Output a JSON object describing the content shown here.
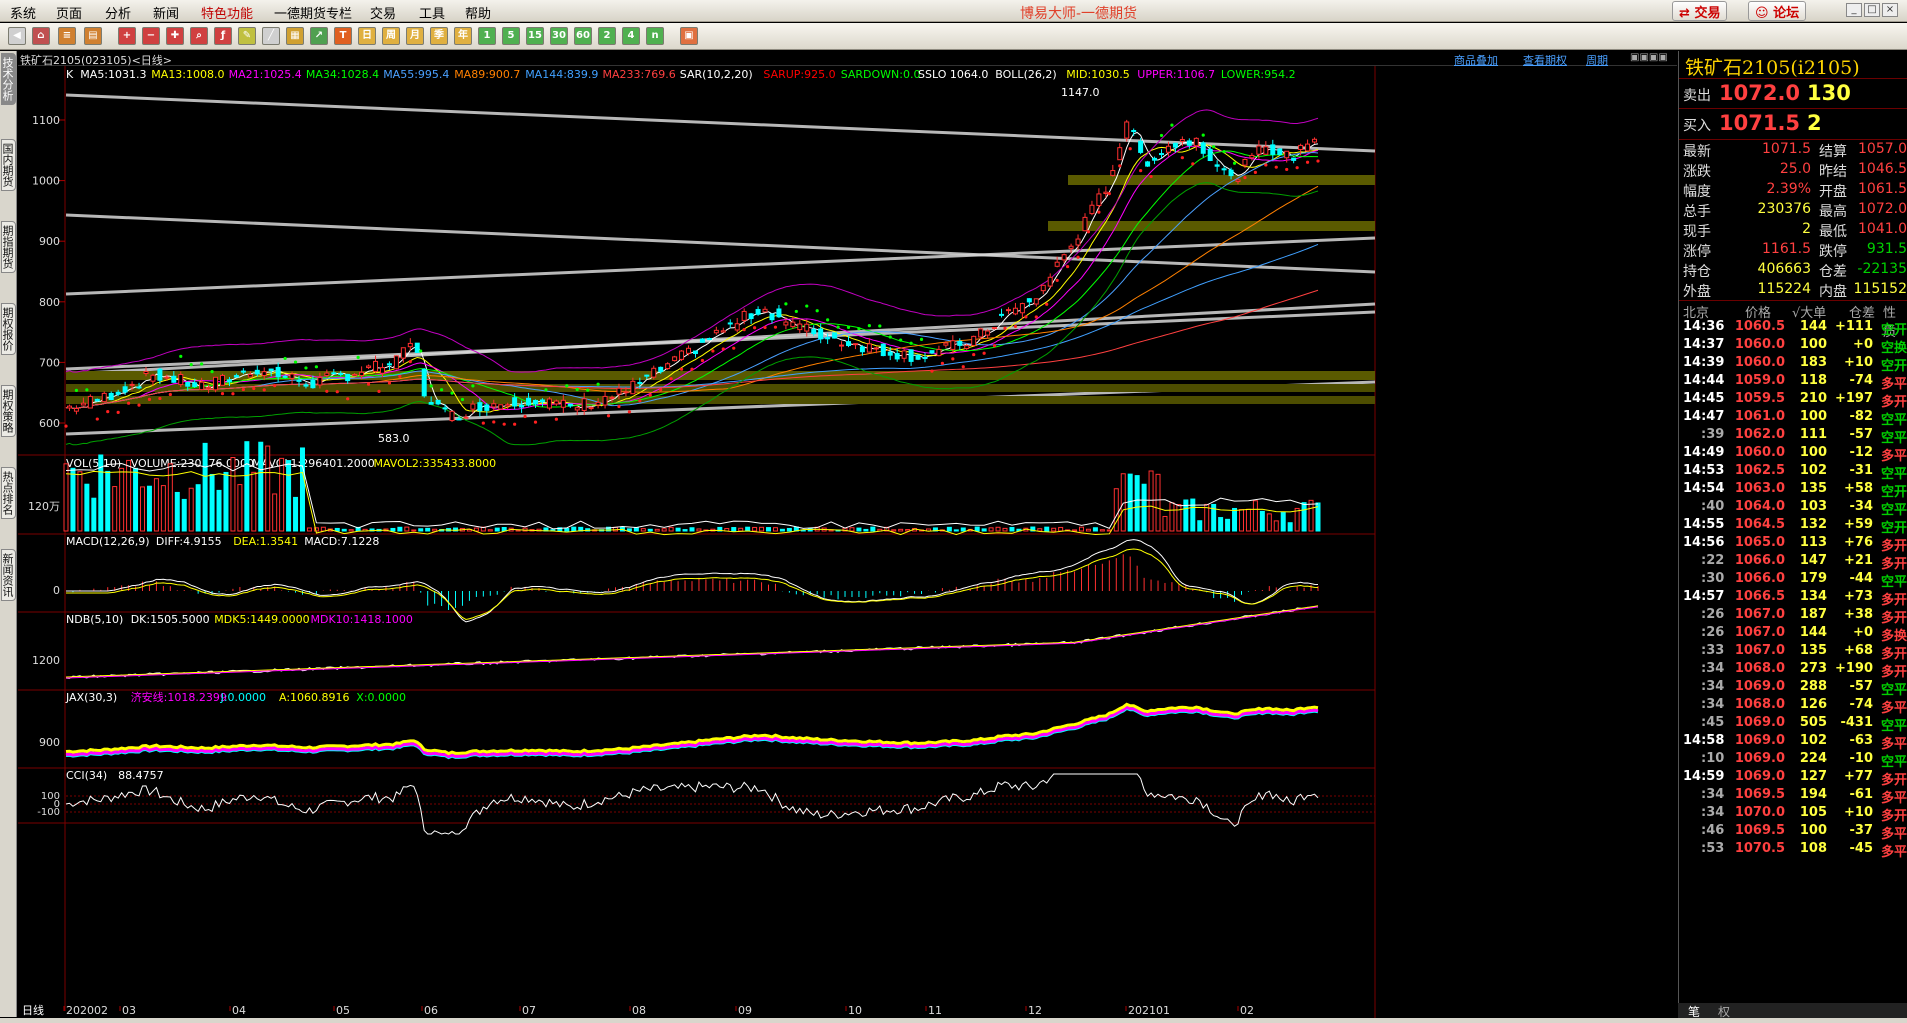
{
  "menu": {
    "items": [
      "系统",
      "页面",
      "分析",
      "新闻",
      "特色功能",
      "一德期货专栏",
      "交易",
      "工具",
      "帮助"
    ],
    "app_title": "博易大师-一德期货",
    "trade_button": "交易",
    "forum_button": "论坛"
  },
  "toolbar": {
    "period_buttons": [
      "周",
      "月",
      "季",
      "年",
      "1",
      "5",
      "15",
      "30",
      "60"
    ]
  },
  "sidebar": {
    "tabs": [
      "技术分析",
      "国内期货",
      "期指期货",
      "期权报价",
      "期权策略",
      "热点排名",
      "新闻资讯"
    ]
  },
  "chart": {
    "instrument": "铁矿石2105(023105)<日线>",
    "header_links": [
      "商品叠加",
      "查看期权",
      "周期"
    ],
    "ma_legend": [
      {
        "text": "K",
        "color": "#ffffff"
      },
      {
        "text": "MA5:1031.3",
        "color": "#ffffff"
      },
      {
        "text": "MA13:1008.0",
        "color": "#ffff00"
      },
      {
        "text": "MA21:1025.4",
        "color": "#ff00ff"
      },
      {
        "text": "MA34:1028.4",
        "color": "#00ff00"
      },
      {
        "text": "MA55:995.4",
        "color": "#4aa0ff"
      },
      {
        "text": "MA89:900.7",
        "color": "#ff8000"
      },
      {
        "text": "MA144:839.9",
        "color": "#40a0ff"
      },
      {
        "text": "MA233:769.6",
        "color": "#ff4040"
      },
      {
        "text": "SAR(10,2,20)",
        "color": "#ffffff"
      },
      {
        "text": "SARUP:925.0",
        "color": "#ff0000"
      },
      {
        "text": "SARDOWN:0.0",
        "color": "#00ff00"
      },
      {
        "text": "SSLO 1064.0",
        "color": "#ffffff"
      },
      {
        "text": "BOLL(26,2)",
        "color": "#ffffff"
      },
      {
        "text": "MID:1030.5",
        "color": "#ffff00"
      },
      {
        "text": "UPPER:1106.7",
        "color": "#ff00ff"
      },
      {
        "text": "LOWER:954.2",
        "color": "#00ff00"
      }
    ],
    "price_ticks": [
      "1100",
      "1000",
      "900",
      "800",
      "700",
      "600"
    ],
    "high_label": "1147.0",
    "low_label": "583.0",
    "vol_legend": [
      {
        "text": "VOL(5,10)",
        "color": "#ffffff"
      },
      {
        "text": "VOLUME:230376.0000",
        "color": "#ffffff"
      },
      {
        "text": "MAVOL1:296401.2000",
        "color": "#ffffff"
      },
      {
        "text": "MAVOL2:335433.8000",
        "color": "#ffff00"
      }
    ],
    "vol_tick": "120万",
    "macd_legend": [
      {
        "text": "MACD(12,26,9)",
        "color": "#ffffff"
      },
      {
        "text": "DIFF:4.9155",
        "color": "#ffffff"
      },
      {
        "text": "DEA:1.3541",
        "color": "#ffff00"
      },
      {
        "text": "MACD:7.1228",
        "color": "#ffffff"
      }
    ],
    "macd_tick": "0",
    "ndb_legend": [
      {
        "text": "NDB(5,10)",
        "color": "#ffffff"
      },
      {
        "text": "DK:1505.5000",
        "color": "#ffffff"
      },
      {
        "text": "MDK5:1449.0000",
        "color": "#ffff00"
      },
      {
        "text": "MDK10:1418.1000",
        "color": "#ff00ff"
      }
    ],
    "ndb_tick": "1200",
    "jax_legend": [
      {
        "text": "JAX(30,3)",
        "color": "#ffffff"
      },
      {
        "text": "济安线:1018.2399",
        "color": "#ff00ff"
      },
      {
        "text": "J:0.0000",
        "color": "#00ffff"
      },
      {
        "text": "A:1060.8916",
        "color": "#ffff00"
      },
      {
        "text": "X:0.0000",
        "color": "#00ff00"
      }
    ],
    "jax_tick": "900",
    "cci_legend": [
      {
        "text": "CCI(34)",
        "color": "#ffffff"
      },
      {
        "text": "88.4757",
        "color": "#ffffff"
      }
    ],
    "cci_ticks": [
      "100",
      "0",
      "-100"
    ],
    "x_labels": [
      "日线",
      "202002",
      "03",
      "04",
      "05",
      "06",
      "07",
      "08",
      "09",
      "10",
      "11",
      "12",
      "202101",
      "02"
    ]
  },
  "quote": {
    "title": "铁矿石2105(i2105)",
    "ask": {
      "label": "卖出",
      "price": "1072.0",
      "volume": "130"
    },
    "bid": {
      "label": "买入",
      "price": "1071.5",
      "volume": "2"
    },
    "rows": [
      {
        "l1": "最新",
        "v1": "1071.5",
        "l2": "结算",
        "v2": "1057.0"
      },
      {
        "l1": "涨跌",
        "v1": "25.0",
        "l2": "昨结",
        "v2": "1046.5"
      },
      {
        "l1": "幅度",
        "v1": "2.39%",
        "l2": "开盘",
        "v2": "1061.5"
      },
      {
        "l1": "总手",
        "v1": "230376",
        "l2": "最高",
        "v2": "1072.0"
      },
      {
        "l1": "现手",
        "v1": "2",
        "l2": "最低",
        "v2": "1041.0"
      },
      {
        "l1": "涨停",
        "v1": "1161.5",
        "l2": "跌停",
        "v2": "931.5"
      },
      {
        "l1": "持仓",
        "v1": "406663",
        "l2": "仓差",
        "v2": "-22135"
      },
      {
        "l1": "外盘",
        "v1": "115224",
        "l2": "内盘",
        "v2": "115152"
      }
    ],
    "tick_header": [
      "北京",
      "价格",
      "√大单",
      "仓差",
      "性质"
    ],
    "ticks": [
      {
        "t": "14:36",
        "p": "1060.5",
        "v": "144",
        "d": "+111",
        "n": "空开"
      },
      {
        "t": "14:37",
        "p": "1060.0",
        "v": "100",
        "d": "+0",
        "n": "空换"
      },
      {
        "t": "14:39",
        "p": "1060.0",
        "v": "183",
        "d": "+10",
        "n": "空开"
      },
      {
        "t": "14:44",
        "p": "1059.0",
        "v": "118",
        "d": "-74",
        "n": "多平"
      },
      {
        "t": "14:45",
        "p": "1059.5",
        "v": "210",
        "d": "+197",
        "n": "多开"
      },
      {
        "t": "14:47",
        "p": "1061.0",
        "v": "100",
        "d": "-82",
        "n": "空平"
      },
      {
        "t": ":39",
        "p": "1062.0",
        "v": "111",
        "d": "-57",
        "n": "空平"
      },
      {
        "t": "14:49",
        "p": "1060.0",
        "v": "100",
        "d": "-12",
        "n": "多平"
      },
      {
        "t": "14:53",
        "p": "1062.5",
        "v": "102",
        "d": "-31",
        "n": "空平"
      },
      {
        "t": "14:54",
        "p": "1063.0",
        "v": "135",
        "d": "+58",
        "n": "空开"
      },
      {
        "t": ":40",
        "p": "1064.0",
        "v": "103",
        "d": "-34",
        "n": "空平"
      },
      {
        "t": "14:55",
        "p": "1064.5",
        "v": "132",
        "d": "+59",
        "n": "空开"
      },
      {
        "t": "14:56",
        "p": "1065.0",
        "v": "113",
        "d": "+76",
        "n": "多开"
      },
      {
        "t": ":22",
        "p": "1066.0",
        "v": "147",
        "d": "+21",
        "n": "多开"
      },
      {
        "t": ":30",
        "p": "1066.0",
        "v": "179",
        "d": "-44",
        "n": "空平"
      },
      {
        "t": "14:57",
        "p": "1066.5",
        "v": "134",
        "d": "+73",
        "n": "多开"
      },
      {
        "t": ":26",
        "p": "1067.0",
        "v": "187",
        "d": "+38",
        "n": "多开"
      },
      {
        "t": ":26",
        "p": "1067.0",
        "v": "144",
        "d": "+0",
        "n": "多换"
      },
      {
        "t": ":33",
        "p": "1067.0",
        "v": "135",
        "d": "+68",
        "n": "多开"
      },
      {
        "t": ":34",
        "p": "1068.0",
        "v": "273",
        "d": "+190",
        "n": "多开"
      },
      {
        "t": ":34",
        "p": "1069.0",
        "v": "288",
        "d": "-57",
        "n": "空平"
      },
      {
        "t": ":34",
        "p": "1068.0",
        "v": "126",
        "d": "-74",
        "n": "多平"
      },
      {
        "t": ":45",
        "p": "1069.0",
        "v": "505",
        "d": "-431",
        "n": "空平"
      },
      {
        "t": "14:58",
        "p": "1069.0",
        "v": "102",
        "d": "-63",
        "n": "多平"
      },
      {
        "t": ":10",
        "p": "1069.0",
        "v": "224",
        "d": "-10",
        "n": "空平"
      },
      {
        "t": "14:59",
        "p": "1069.0",
        "v": "127",
        "d": "+77",
        "n": "多开"
      },
      {
        "t": ":34",
        "p": "1069.5",
        "v": "194",
        "d": "-61",
        "n": "多平"
      },
      {
        "t": ":34",
        "p": "1070.0",
        "v": "105",
        "d": "+10",
        "n": "多开"
      },
      {
        "t": ":46",
        "p": "1069.5",
        "v": "100",
        "d": "-37",
        "n": "多平"
      },
      {
        "t": ":53",
        "p": "1070.5",
        "v": "108",
        "d": "-45",
        "n": "多平"
      }
    ],
    "bottom_tabs": [
      "笔",
      "权"
    ]
  }
}
